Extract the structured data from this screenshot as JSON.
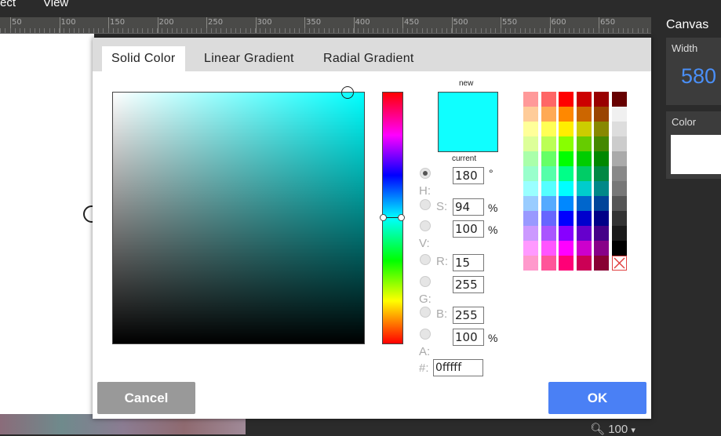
{
  "menu": {
    "item1": "ect",
    "item2": "View"
  },
  "ruler": {
    "numbers": [
      "50",
      "100",
      "150",
      "200",
      "250",
      "300",
      "350",
      "400",
      "450",
      "500",
      "550",
      "600",
      "650"
    ]
  },
  "right_panel": {
    "title": "Canvas",
    "width_label": "Width",
    "width_value": "580",
    "color_label": "Color"
  },
  "status": {
    "zoom_value": "100",
    "zoom_caret": "▾",
    "zoom_icon": "search-icon"
  },
  "dialog": {
    "tabs": [
      "Solid Color",
      "Linear Gradient",
      "Radial Gradient"
    ],
    "active_tab": "Solid Color",
    "new_label": "new",
    "current_label": "current",
    "new_color": "#0fffff",
    "fields": {
      "H": {
        "label": "H:",
        "value": "180",
        "unit": "°"
      },
      "S": {
        "label": "S:",
        "value": "94",
        "unit": "%"
      },
      "V": {
        "label": "V:",
        "value": "100",
        "unit": "%"
      },
      "R": {
        "label": "R:",
        "value": "15"
      },
      "G": {
        "label": "G:",
        "value": "255"
      },
      "B": {
        "label": "B:",
        "value": "255"
      },
      "A": {
        "label": "A:",
        "value": "100",
        "unit": "%"
      },
      "hex": {
        "label": "#:",
        "value": "0fffff"
      }
    },
    "cancel_label": "Cancel",
    "ok_label": "OK",
    "palette": [
      [
        "#ff9999",
        "#ff6666",
        "#ff0000",
        "#cc0000",
        "#990000",
        "#660000"
      ],
      [
        "#ffcc99",
        "#ffaa55",
        "#ff8800",
        "#cc6600",
        "#994400",
        "#f0f0f0"
      ],
      [
        "#ffff99",
        "#ffff55",
        "#ffee00",
        "#cccc00",
        "#888800",
        "#dddddd"
      ],
      [
        "#ddff99",
        "#bbff55",
        "#88ff00",
        "#66cc00",
        "#448800",
        "#cccccc"
      ],
      [
        "#aaffaa",
        "#66ff66",
        "#00ff00",
        "#00cc00",
        "#008800",
        "#aaaaaa"
      ],
      [
        "#99ffcc",
        "#55ffaa",
        "#00ff88",
        "#00cc66",
        "#008844",
        "#888888"
      ],
      [
        "#99ffff",
        "#55ffff",
        "#00ffff",
        "#00cccc",
        "#008888",
        "#777777"
      ],
      [
        "#99ccff",
        "#55aaff",
        "#0088ff",
        "#0066cc",
        "#004499",
        "#555555"
      ],
      [
        "#9999ff",
        "#6666ff",
        "#0000ff",
        "#0000cc",
        "#000088",
        "#333333"
      ],
      [
        "#cc99ff",
        "#aa55ff",
        "#8800ff",
        "#6600cc",
        "#440088",
        "#1a1a1a"
      ],
      [
        "#ff99ff",
        "#ff55ff",
        "#ff00ff",
        "#cc00cc",
        "#880088",
        "#000000"
      ],
      [
        "#ff99cc",
        "#ff5599",
        "#ff0077",
        "#cc0055",
        "#880033",
        "none"
      ]
    ]
  }
}
